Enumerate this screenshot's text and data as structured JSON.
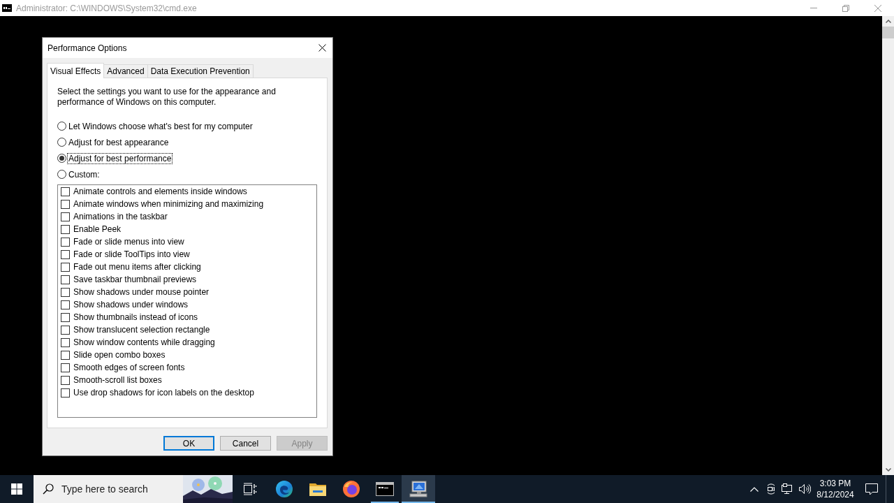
{
  "console_window": {
    "title": "Administrator: C:\\WINDOWS\\System32\\cmd.exe"
  },
  "dialog": {
    "title": "Performance Options",
    "tabs": [
      {
        "label": "Visual Effects",
        "selected": true
      },
      {
        "label": "Advanced",
        "selected": false
      },
      {
        "label": "Data Execution Prevention",
        "selected": false
      }
    ],
    "description": "Select the settings you want to use for the appearance and performance of Windows on this computer.",
    "options": [
      {
        "label": "Let Windows choose what's best for my computer",
        "selected": false
      },
      {
        "label": "Adjust for best appearance",
        "selected": false
      },
      {
        "label": "Adjust for best performance",
        "selected": true
      },
      {
        "label": "Custom:",
        "selected": false
      }
    ],
    "effects": [
      {
        "label": "Animate controls and elements inside windows",
        "checked": false
      },
      {
        "label": "Animate windows when minimizing and maximizing",
        "checked": false
      },
      {
        "label": "Animations in the taskbar",
        "checked": false
      },
      {
        "label": "Enable Peek",
        "checked": false
      },
      {
        "label": "Fade or slide menus into view",
        "checked": false
      },
      {
        "label": "Fade or slide ToolTips into view",
        "checked": false
      },
      {
        "label": "Fade out menu items after clicking",
        "checked": false
      },
      {
        "label": "Save taskbar thumbnail previews",
        "checked": false
      },
      {
        "label": "Show shadows under mouse pointer",
        "checked": false
      },
      {
        "label": "Show shadows under windows",
        "checked": false
      },
      {
        "label": "Show thumbnails instead of icons",
        "checked": false
      },
      {
        "label": "Show translucent selection rectangle",
        "checked": false
      },
      {
        "label": "Show window contents while dragging",
        "checked": false
      },
      {
        "label": "Slide open combo boxes",
        "checked": false
      },
      {
        "label": "Smooth edges of screen fonts",
        "checked": false
      },
      {
        "label": "Smooth-scroll list boxes",
        "checked": false
      },
      {
        "label": "Use drop shadows for icon labels on the desktop",
        "checked": false
      }
    ],
    "buttons": [
      {
        "label": "OK",
        "default": true,
        "disabled": false
      },
      {
        "label": "Cancel",
        "default": false,
        "disabled": false
      },
      {
        "label": "Apply",
        "default": false,
        "disabled": true
      }
    ]
  },
  "taskbar": {
    "search": {
      "placeholder": "Type here to search"
    },
    "apps": [
      {
        "kind": "browser",
        "running": false,
        "active": false
      },
      {
        "kind": "folder",
        "running": false,
        "active": false
      },
      {
        "kind": "globe",
        "running": false,
        "active": false
      },
      {
        "kind": "terminal",
        "running": true,
        "active": false
      },
      {
        "kind": "computer",
        "running": true,
        "active": true
      }
    ],
    "clock": {
      "time": "3:03 PM",
      "date": "8/12/2024"
    }
  }
}
